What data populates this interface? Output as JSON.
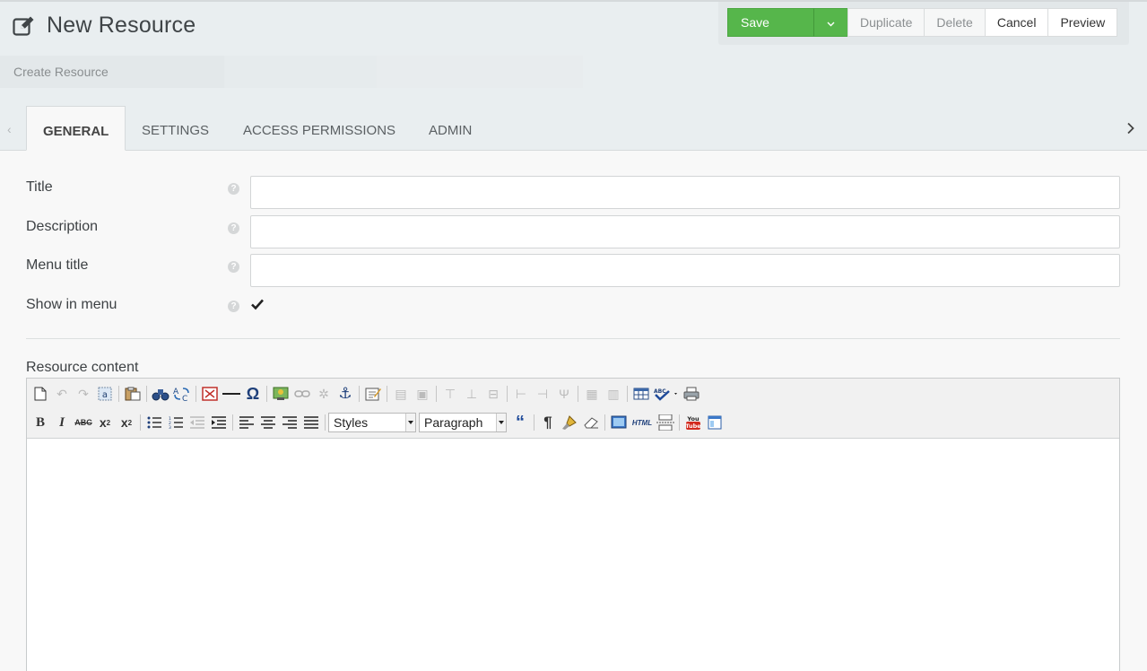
{
  "header": {
    "title": "New Resource",
    "title_icon": "edit-icon"
  },
  "actions": {
    "save": "Save",
    "duplicate": "Duplicate",
    "delete": "Delete",
    "cancel": "Cancel",
    "preview": "Preview"
  },
  "breadcrumb": {
    "text": "Create Resource"
  },
  "tabs": [
    {
      "label": "GENERAL",
      "active": true
    },
    {
      "label": "SETTINGS",
      "active": false
    },
    {
      "label": "ACCESS PERMISSIONS",
      "active": false
    },
    {
      "label": "ADMIN",
      "active": false
    }
  ],
  "form": {
    "title_label": "Title",
    "title_value": "",
    "description_label": "Description",
    "description_value": "",
    "menu_title_label": "Menu title",
    "menu_title_value": "",
    "show_in_menu_label": "Show in menu",
    "show_in_menu_checked": true,
    "help_icon": "question-circle-icon"
  },
  "editor": {
    "label": "Resource content",
    "styles_select": "Styles",
    "format_select": "Paragraph",
    "content": ""
  },
  "colors": {
    "save_green": "#56b64b",
    "header_bg": "#e9eef0"
  }
}
